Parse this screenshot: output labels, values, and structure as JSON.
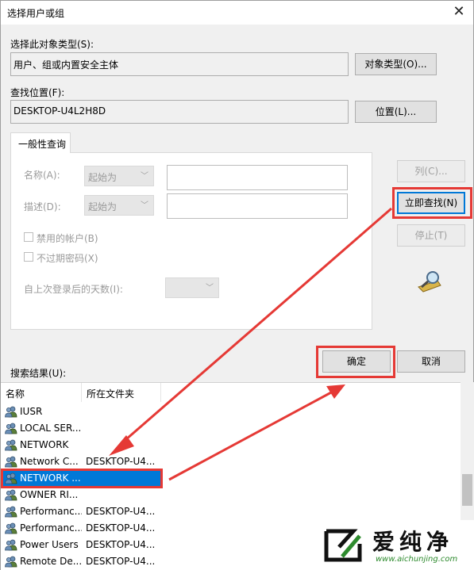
{
  "window": {
    "title": "选择用户或组"
  },
  "object_type": {
    "label": "选择此对象类型(S):",
    "value": "用户、组或内置安全主体",
    "button": "对象类型(O)..."
  },
  "location": {
    "label": "查找位置(F):",
    "value": "DESKTOP-U4L2H8D",
    "button": "位置(L)..."
  },
  "query_tab": {
    "label": "一般性查询",
    "name_label": "名称(A):",
    "name_combo": "起始为",
    "desc_label": "描述(D):",
    "desc_combo": "起始为",
    "disabled_accounts": "禁用的帐户(B)",
    "no_expire_password": "不过期密码(X)",
    "days_since_logon": "自上次登录后的天数(I):"
  },
  "side_buttons": {
    "columns": "列(C)...",
    "find_now": "立即查找(N)",
    "stop": "停止(T)"
  },
  "footer_buttons": {
    "ok": "确定",
    "cancel": "取消"
  },
  "results": {
    "label": "搜索结果(U):",
    "columns": [
      "名称",
      "所在文件夹"
    ],
    "rows": [
      {
        "name": "IUSR",
        "folder": ""
      },
      {
        "name": "LOCAL SER...",
        "folder": ""
      },
      {
        "name": "NETWORK",
        "folder": ""
      },
      {
        "name": "Network C...",
        "folder": "DESKTOP-U4..."
      },
      {
        "name": "NETWORK ...",
        "folder": ""
      },
      {
        "name": "OWNER RI...",
        "folder": ""
      },
      {
        "name": "Performanc...",
        "folder": "DESKTOP-U4..."
      },
      {
        "name": "Performanc...",
        "folder": "DESKTOP-U4..."
      },
      {
        "name": "Power Users",
        "folder": "DESKTOP-U4..."
      },
      {
        "name": "Remote De...",
        "folder": "DESKTOP-U4..."
      }
    ],
    "selected_row": 4
  },
  "watermark": {
    "name": "爱纯净",
    "url": "www.aichunjing.com"
  },
  "colors": {
    "selection": "#0078d7",
    "annotation_red": "#e53935",
    "watermark_green": "#2e8b2e"
  }
}
